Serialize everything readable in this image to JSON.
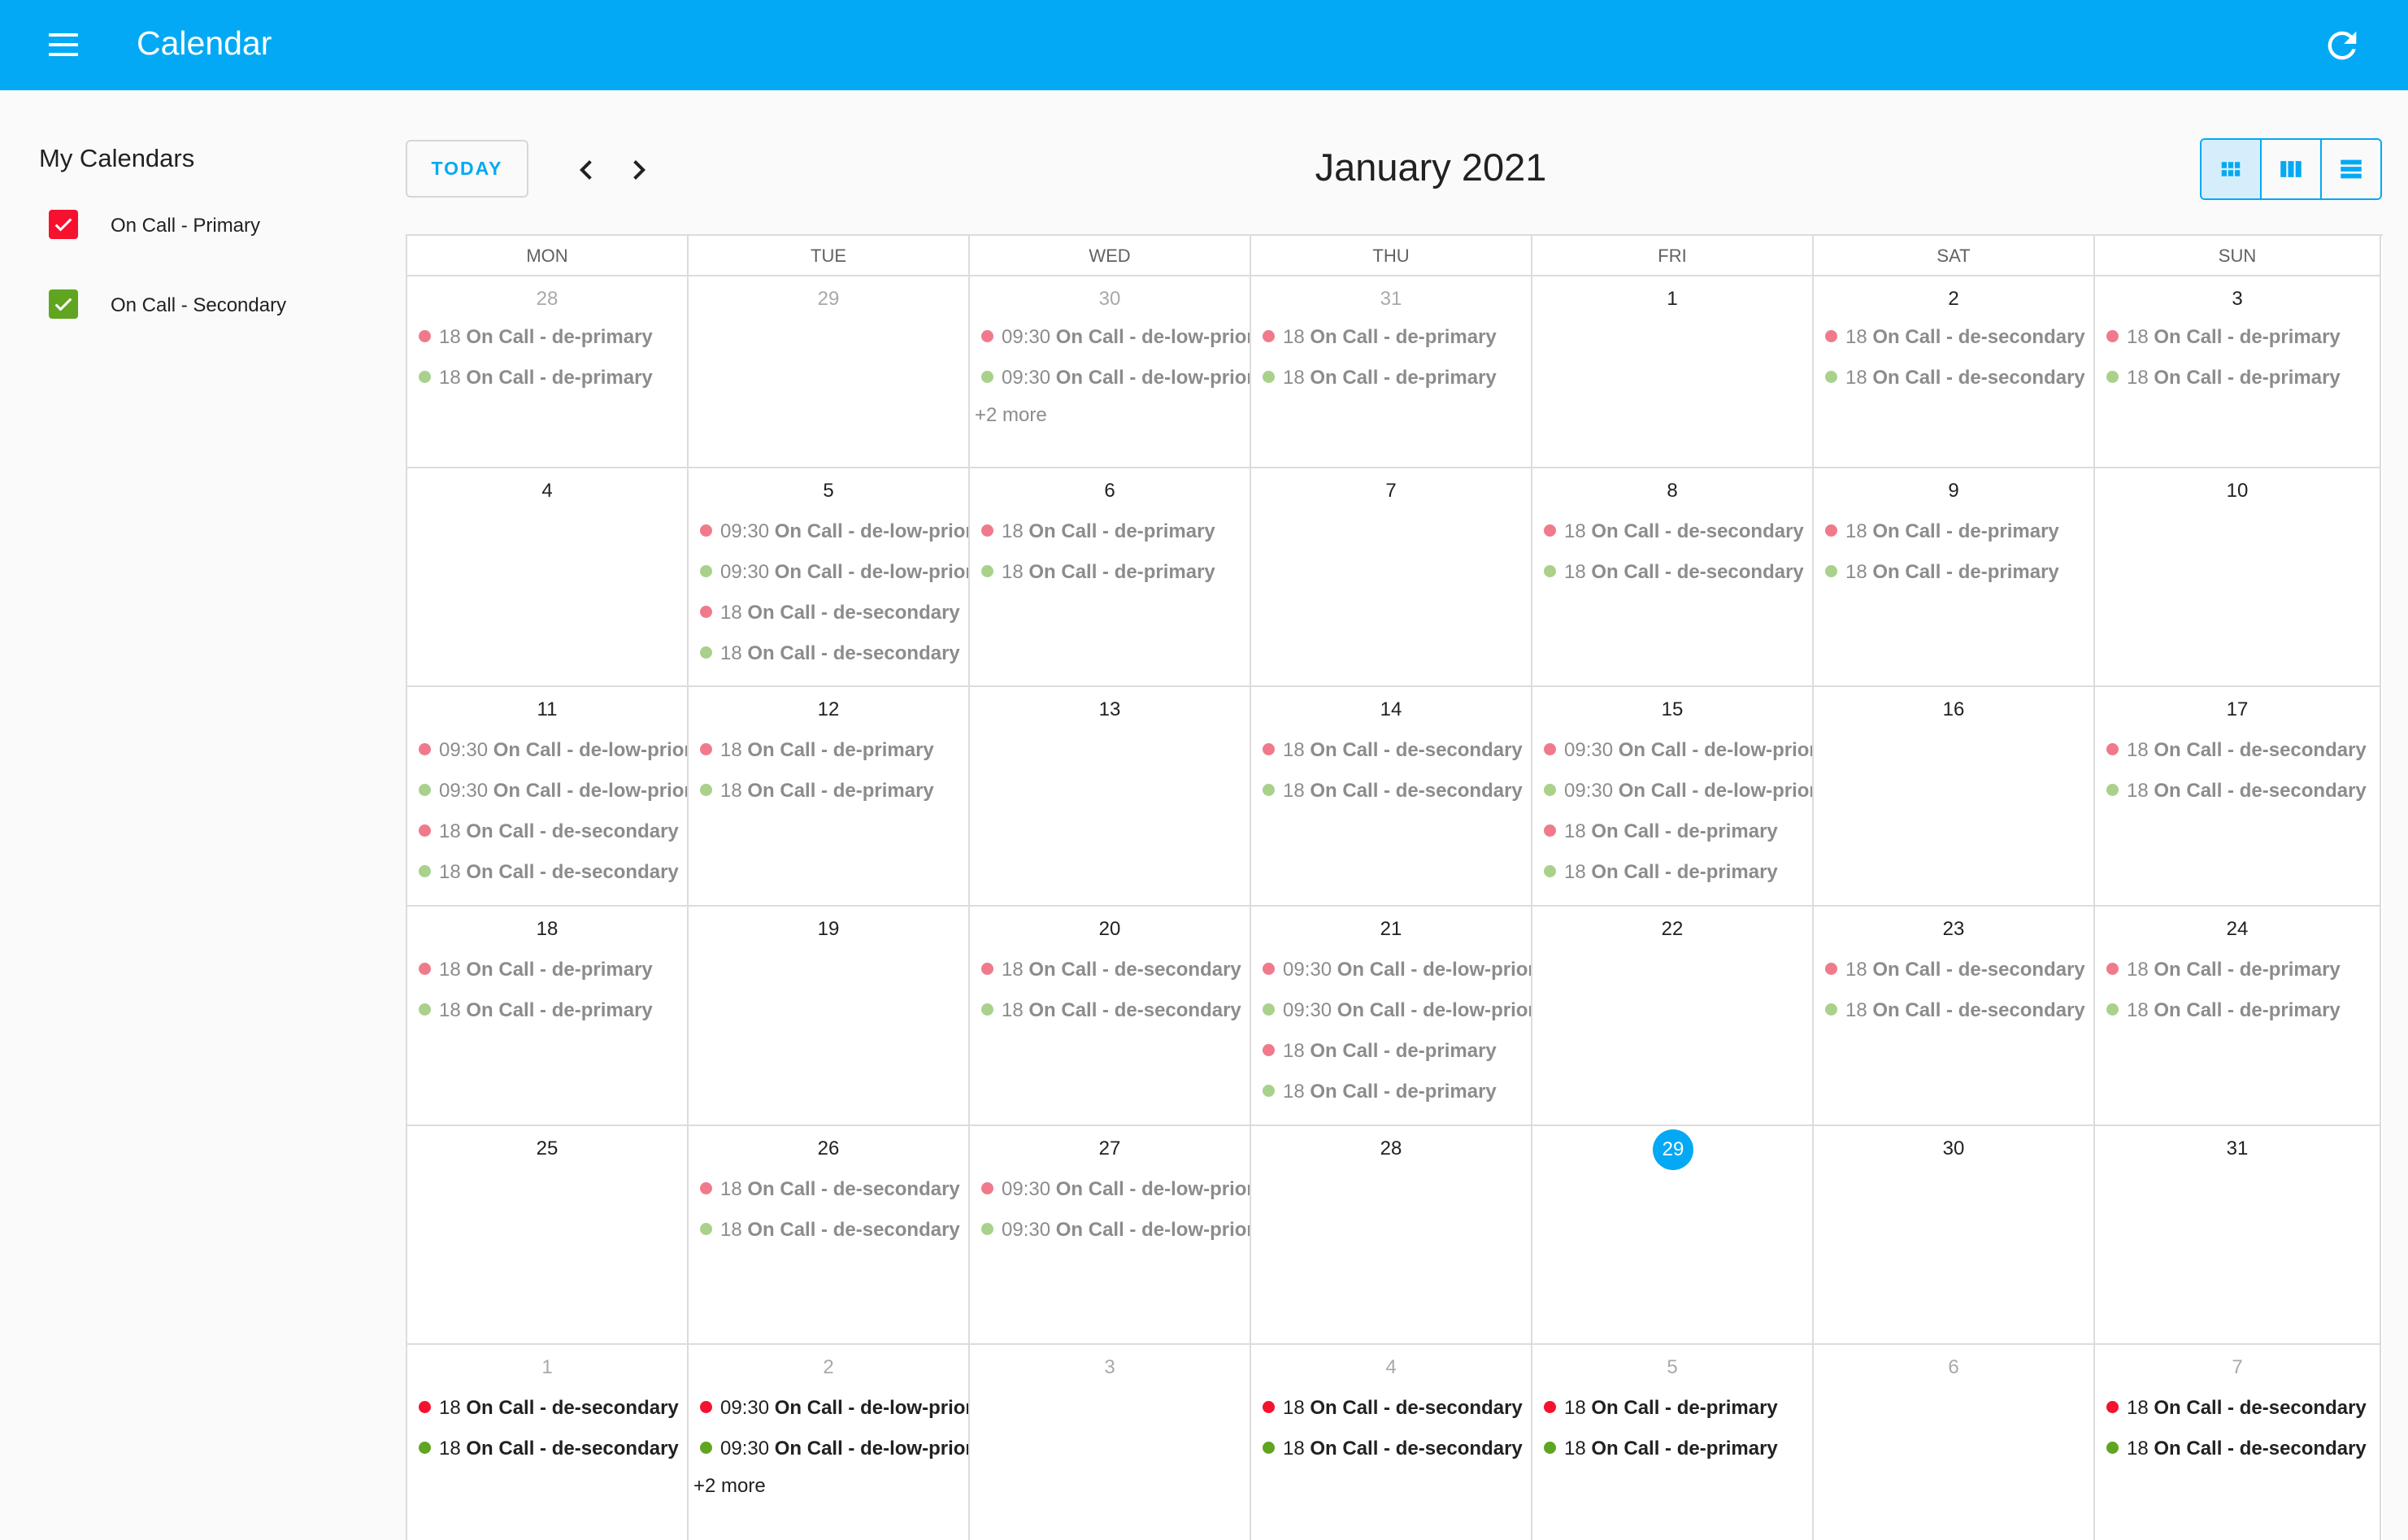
{
  "app": {
    "title": "Calendar"
  },
  "sidebar": {
    "title": "My Calendars",
    "calendars": [
      {
        "label": "On Call - Primary",
        "color": "#f6122e",
        "checked": true
      },
      {
        "label": "On Call - Secondary",
        "color": "#5fa520",
        "checked": true
      }
    ]
  },
  "toolbar": {
    "today_label": "TODAY",
    "month_title": "January 2021"
  },
  "colors": {
    "primary": "#f6122e",
    "secondary": "#5fa520",
    "primary_faded": "#f07a8b",
    "secondary_faded": "#a9d18b",
    "accent": "#03a9f4"
  },
  "weekdays": [
    "MON",
    "TUE",
    "WED",
    "THU",
    "FRI",
    "SAT",
    "SUN"
  ],
  "weeks": [
    [
      {
        "day": "28",
        "other": true,
        "events": [
          {
            "time": "18",
            "title": "On Call - de-primary",
            "cal": "p"
          },
          {
            "time": "18",
            "title": "On Call - de-primary",
            "cal": "s"
          }
        ]
      },
      {
        "day": "29",
        "other": true,
        "events": []
      },
      {
        "day": "30",
        "other": true,
        "events": [
          {
            "time": "09:30",
            "title": "On Call - de-low-priority",
            "cal": "p"
          },
          {
            "time": "09:30",
            "title": "On Call - de-low-priority",
            "cal": "s"
          }
        ],
        "more": "+2 more"
      },
      {
        "day": "31",
        "other": true,
        "events": [
          {
            "time": "18",
            "title": "On Call - de-primary",
            "cal": "p"
          },
          {
            "time": "18",
            "title": "On Call - de-primary",
            "cal": "s"
          }
        ]
      },
      {
        "day": "1",
        "events": []
      },
      {
        "day": "2",
        "events": [
          {
            "time": "18",
            "title": "On Call - de-secondary",
            "cal": "p"
          },
          {
            "time": "18",
            "title": "On Call - de-secondary",
            "cal": "s"
          }
        ]
      },
      {
        "day": "3",
        "events": [
          {
            "time": "18",
            "title": "On Call - de-primary",
            "cal": "p"
          },
          {
            "time": "18",
            "title": "On Call - de-primary",
            "cal": "s"
          }
        ]
      }
    ],
    [
      {
        "day": "4",
        "events": []
      },
      {
        "day": "5",
        "events": [
          {
            "time": "09:30",
            "title": "On Call - de-low-priority",
            "cal": "p"
          },
          {
            "time": "09:30",
            "title": "On Call - de-low-priority",
            "cal": "s"
          },
          {
            "time": "18",
            "title": "On Call - de-secondary",
            "cal": "p"
          },
          {
            "time": "18",
            "title": "On Call - de-secondary",
            "cal": "s"
          }
        ]
      },
      {
        "day": "6",
        "events": [
          {
            "time": "18",
            "title": "On Call - de-primary",
            "cal": "p"
          },
          {
            "time": "18",
            "title": "On Call - de-primary",
            "cal": "s"
          }
        ]
      },
      {
        "day": "7",
        "events": []
      },
      {
        "day": "8",
        "events": [
          {
            "time": "18",
            "title": "On Call - de-secondary",
            "cal": "p"
          },
          {
            "time": "18",
            "title": "On Call - de-secondary",
            "cal": "s"
          }
        ]
      },
      {
        "day": "9",
        "events": [
          {
            "time": "18",
            "title": "On Call - de-primary",
            "cal": "p"
          },
          {
            "time": "18",
            "title": "On Call - de-primary",
            "cal": "s"
          }
        ]
      },
      {
        "day": "10",
        "events": []
      }
    ],
    [
      {
        "day": "11",
        "events": [
          {
            "time": "09:30",
            "title": "On Call - de-low-priority",
            "cal": "p"
          },
          {
            "time": "09:30",
            "title": "On Call - de-low-priority",
            "cal": "s"
          },
          {
            "time": "18",
            "title": "On Call - de-secondary",
            "cal": "p"
          },
          {
            "time": "18",
            "title": "On Call - de-secondary",
            "cal": "s"
          }
        ]
      },
      {
        "day": "12",
        "events": [
          {
            "time": "18",
            "title": "On Call - de-primary",
            "cal": "p"
          },
          {
            "time": "18",
            "title": "On Call - de-primary",
            "cal": "s"
          }
        ]
      },
      {
        "day": "13",
        "events": []
      },
      {
        "day": "14",
        "events": [
          {
            "time": "18",
            "title": "On Call - de-secondary",
            "cal": "p"
          },
          {
            "time": "18",
            "title": "On Call - de-secondary",
            "cal": "s"
          }
        ]
      },
      {
        "day": "15",
        "events": [
          {
            "time": "09:30",
            "title": "On Call - de-low-priority",
            "cal": "p"
          },
          {
            "time": "09:30",
            "title": "On Call - de-low-priority",
            "cal": "s"
          },
          {
            "time": "18",
            "title": "On Call - de-primary",
            "cal": "p"
          },
          {
            "time": "18",
            "title": "On Call - de-primary",
            "cal": "s"
          }
        ]
      },
      {
        "day": "16",
        "events": []
      },
      {
        "day": "17",
        "events": [
          {
            "time": "18",
            "title": "On Call - de-secondary",
            "cal": "p"
          },
          {
            "time": "18",
            "title": "On Call - de-secondary",
            "cal": "s"
          }
        ]
      }
    ],
    [
      {
        "day": "18",
        "events": [
          {
            "time": "18",
            "title": "On Call - de-primary",
            "cal": "p"
          },
          {
            "time": "18",
            "title": "On Call - de-primary",
            "cal": "s"
          }
        ]
      },
      {
        "day": "19",
        "events": []
      },
      {
        "day": "20",
        "events": [
          {
            "time": "18",
            "title": "On Call - de-secondary",
            "cal": "p"
          },
          {
            "time": "18",
            "title": "On Call - de-secondary",
            "cal": "s"
          }
        ]
      },
      {
        "day": "21",
        "events": [
          {
            "time": "09:30",
            "title": "On Call - de-low-priority",
            "cal": "p"
          },
          {
            "time": "09:30",
            "title": "On Call - de-low-priority",
            "cal": "s"
          },
          {
            "time": "18",
            "title": "On Call - de-primary",
            "cal": "p"
          },
          {
            "time": "18",
            "title": "On Call - de-primary",
            "cal": "s"
          }
        ]
      },
      {
        "day": "22",
        "events": []
      },
      {
        "day": "23",
        "events": [
          {
            "time": "18",
            "title": "On Call - de-secondary",
            "cal": "p"
          },
          {
            "time": "18",
            "title": "On Call - de-secondary",
            "cal": "s"
          }
        ]
      },
      {
        "day": "24",
        "events": [
          {
            "time": "18",
            "title": "On Call - de-primary",
            "cal": "p"
          },
          {
            "time": "18",
            "title": "On Call - de-primary",
            "cal": "s"
          }
        ]
      }
    ],
    [
      {
        "day": "25",
        "events": []
      },
      {
        "day": "26",
        "events": [
          {
            "time": "18",
            "title": "On Call - de-secondary",
            "cal": "p"
          },
          {
            "time": "18",
            "title": "On Call - de-secondary",
            "cal": "s"
          }
        ]
      },
      {
        "day": "27",
        "events": [
          {
            "time": "09:30",
            "title": "On Call - de-low-priority",
            "cal": "p"
          },
          {
            "time": "09:30",
            "title": "On Call - de-low-priority",
            "cal": "s"
          }
        ]
      },
      {
        "day": "28",
        "events": []
      },
      {
        "day": "29",
        "today": true,
        "events": []
      },
      {
        "day": "30",
        "events": []
      },
      {
        "day": "31",
        "events": []
      }
    ],
    [
      {
        "day": "1",
        "other": true,
        "future": true,
        "events": [
          {
            "time": "18",
            "title": "On Call - de-secondary",
            "cal": "p"
          },
          {
            "time": "18",
            "title": "On Call - de-secondary",
            "cal": "s"
          }
        ]
      },
      {
        "day": "2",
        "other": true,
        "future": true,
        "events": [
          {
            "time": "09:30",
            "title": "On Call - de-low-priority",
            "cal": "p"
          },
          {
            "time": "09:30",
            "title": "On Call - de-low-priority",
            "cal": "s"
          }
        ],
        "more": "+2 more"
      },
      {
        "day": "3",
        "other": true,
        "future": true,
        "events": []
      },
      {
        "day": "4",
        "other": true,
        "future": true,
        "events": [
          {
            "time": "18",
            "title": "On Call - de-secondary",
            "cal": "p"
          },
          {
            "time": "18",
            "title": "On Call - de-secondary",
            "cal": "s"
          }
        ]
      },
      {
        "day": "5",
        "other": true,
        "future": true,
        "events": [
          {
            "time": "18",
            "title": "On Call - de-primary",
            "cal": "p"
          },
          {
            "time": "18",
            "title": "On Call - de-primary",
            "cal": "s"
          }
        ]
      },
      {
        "day": "6",
        "other": true,
        "future": true,
        "events": []
      },
      {
        "day": "7",
        "other": true,
        "future": true,
        "events": [
          {
            "time": "18",
            "title": "On Call - de-secondary",
            "cal": "p"
          },
          {
            "time": "18",
            "title": "On Call - de-secondary",
            "cal": "s"
          }
        ]
      }
    ]
  ]
}
